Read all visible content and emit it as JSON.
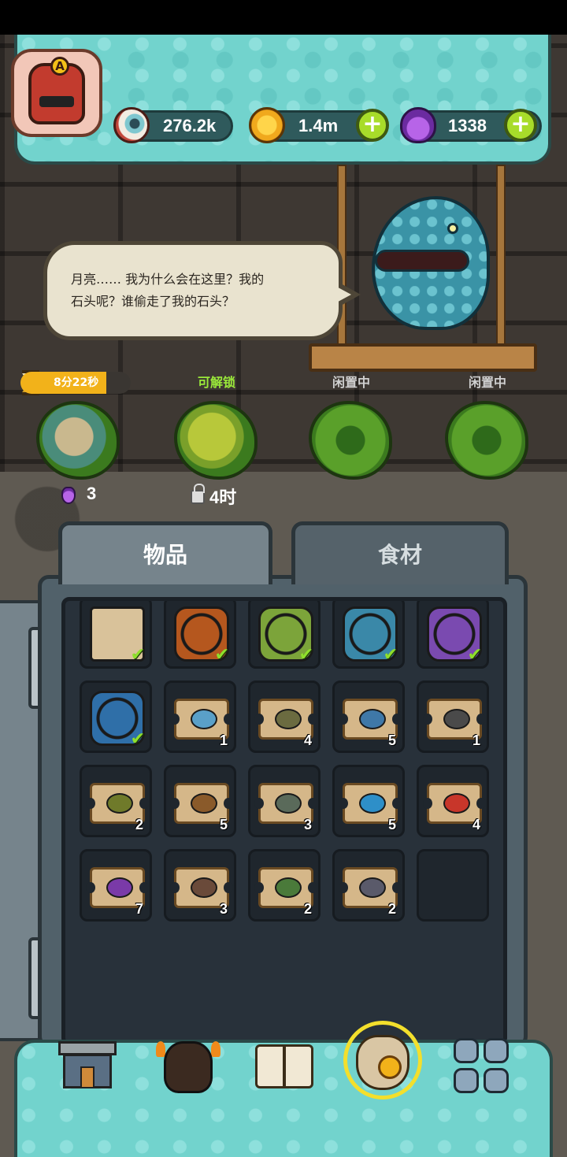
{
  "header": {
    "avatar_letter": "A",
    "resources": [
      {
        "name": "eyes",
        "icon": "eyeball-icon",
        "value": "276.2k"
      },
      {
        "name": "coins",
        "icon": "gold-coin-icon",
        "value": "1.4m"
      },
      {
        "name": "potions",
        "icon": "purple-potion-icon",
        "value": "1338"
      }
    ],
    "plus_label": "+"
  },
  "dialog": {
    "line1": "月亮…… 我为什么会在这里？我的",
    "line2": "石头呢？谁偷走了我的石头？"
  },
  "pods": [
    {
      "status": "timer",
      "timer": "8分22秒",
      "count": "3"
    },
    {
      "status": "可解锁",
      "lock_time": "4时"
    },
    {
      "status": "闲置中"
    },
    {
      "status": "闲置中"
    }
  ],
  "tabs": [
    {
      "label": "物品",
      "active": true
    },
    {
      "label": "食材",
      "active": false
    }
  ],
  "inventory": [
    {
      "kind": "scroll",
      "color": "#d9c29a",
      "checked": true
    },
    {
      "kind": "relic",
      "color": "#b5571e",
      "checked": true
    },
    {
      "kind": "relic",
      "color": "#7ca43a",
      "checked": true
    },
    {
      "kind": "relic",
      "color": "#3a88a8",
      "checked": true
    },
    {
      "kind": "relic",
      "color": "#7a4ab0",
      "checked": true
    },
    {
      "kind": "relic",
      "color": "#2f6fa8",
      "checked": true
    },
    {
      "kind": "ticket",
      "color": "#5aa0c8",
      "count": "1"
    },
    {
      "kind": "ticket",
      "color": "#6b6b40",
      "count": "4"
    },
    {
      "kind": "ticket",
      "color": "#3f78a8",
      "count": "5"
    },
    {
      "kind": "ticket",
      "color": "#4a4a4a",
      "count": "1"
    },
    {
      "kind": "ticket",
      "color": "#6f7a2a",
      "count": "2"
    },
    {
      "kind": "ticket",
      "color": "#8a5a2a",
      "count": "5"
    },
    {
      "kind": "ticket",
      "color": "#5a6a5a",
      "count": "3"
    },
    {
      "kind": "ticket",
      "color": "#2e8fc8",
      "count": "5"
    },
    {
      "kind": "ticket",
      "color": "#c8362a",
      "count": "4"
    },
    {
      "kind": "ticket",
      "color": "#7a3aa8",
      "count": "7"
    },
    {
      "kind": "ticket",
      "color": "#6a4a3a",
      "count": "3"
    },
    {
      "kind": "ticket",
      "color": "#4a7a3a",
      "count": "2"
    },
    {
      "kind": "ticket",
      "color": "#5a5a6a",
      "count": "2"
    },
    {
      "kind": "empty"
    }
  ],
  "nav": [
    {
      "name": "shop",
      "icon": "shop-building-icon"
    },
    {
      "name": "chief",
      "icon": "tribal-chief-icon"
    },
    {
      "name": "book",
      "icon": "open-book-icon"
    },
    {
      "name": "bag",
      "icon": "money-bag-icon",
      "selected": true
    },
    {
      "name": "menu",
      "icon": "grid-menu-icon"
    }
  ],
  "colors": {
    "teal": "#72d3cd",
    "accent_green": "#a8dc2a",
    "timer_orange": "#f2b21a",
    "unlock_green": "#9ae83a",
    "idle_gray": "#d0d0d0"
  }
}
